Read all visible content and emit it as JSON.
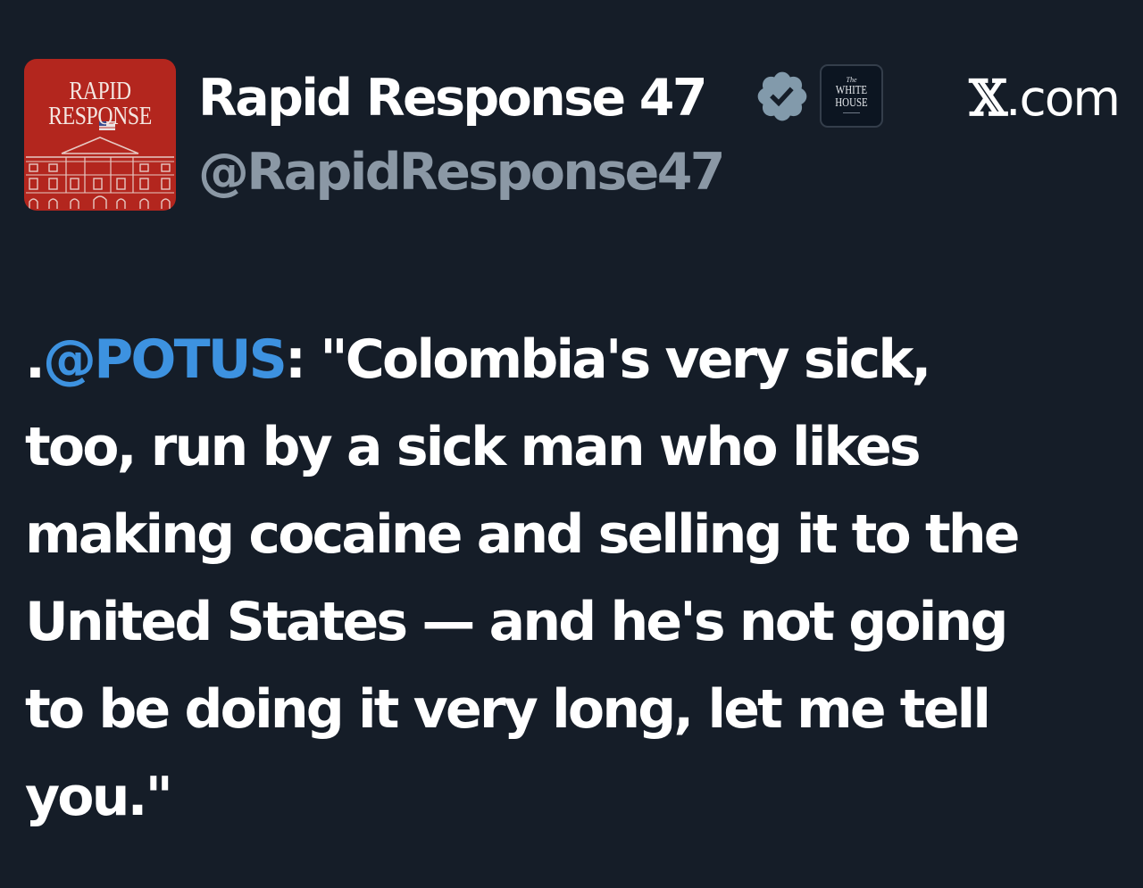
{
  "profile": {
    "avatar_text": "RAPID\nRESPONSE",
    "display_name": "Rapid Response 47",
    "verified_icon": "verified-badge-icon",
    "affiliation_label": "WHITE\nHOUSE",
    "affiliation_label_prefix": "The",
    "handle": "@RapidResponse47",
    "site_prefix": "𝕏",
    "site_suffix": ".com"
  },
  "colors": {
    "background": "#151d28",
    "text": "#ffffff",
    "handle": "#8b98a5",
    "mention": "#3d92e0",
    "avatar": "#b3261e",
    "verified_badge": "#829aab"
  },
  "tweet": {
    "prefix": ".",
    "mention": "@POTUS",
    "line1_rest": ": \"Colombia's very sick,",
    "line2": "too, run by a sick man who likes",
    "line3": "making cocaine and selling it to the",
    "line4": "United States — and he's not going",
    "line5": "to be doing it very long, let me tell",
    "line6": "you.\""
  }
}
